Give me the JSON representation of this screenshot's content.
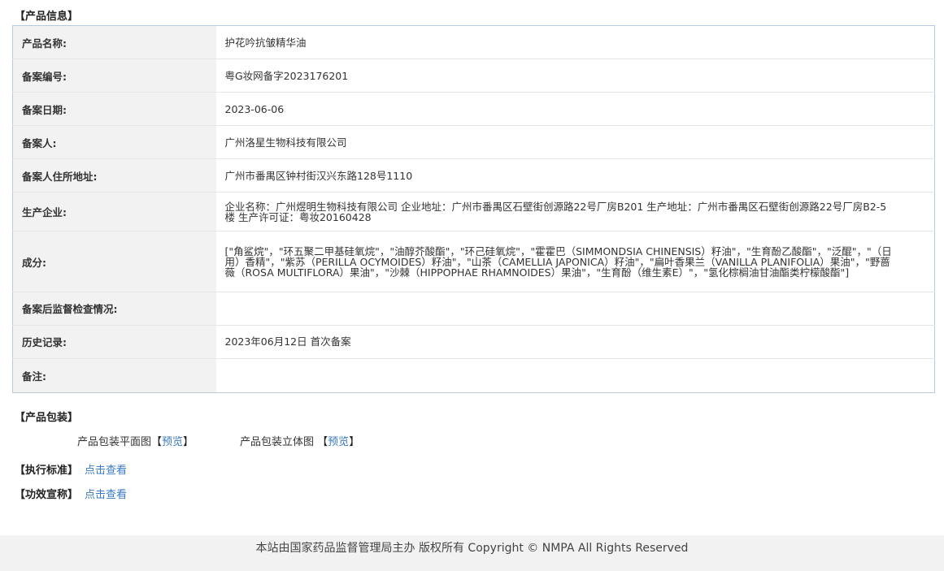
{
  "sections": {
    "product_info": "【产品信息】",
    "packaging": "【产品包装】"
  },
  "rows": [
    {
      "label": "产品名称:",
      "value": "护花吟抗皱精华油"
    },
    {
      "label": "备案编号:",
      "value": "粤G妆网备字2023176201"
    },
    {
      "label": "备案日期:",
      "value": "2023-06-06"
    },
    {
      "label": "备案人:",
      "value": "广州洛星生物科技有限公司"
    },
    {
      "label": "备案人住所地址:",
      "value": "广州市番禺区钟村街汉兴东路128号1110"
    },
    {
      "label": "生产企业:",
      "value": "企业名称：广州煜明生物科技有限公司 企业地址：广州市番禺区石壁街创源路22号厂房B201 生产地址：广州市番禺区石壁街创源路22号厂房B2-5楼 生产许可证：粤妆20160428"
    },
    {
      "label": "成分:",
      "value": "[\"角鲨烷\"，\"环五聚二甲基硅氧烷\"，\"油醇芥酸酯\"，\"环己硅氧烷\"，\"霍霍巴（SIMMONDSIA CHINENSIS）籽油\"，\"生育酚乙酸酯\"，\"泛醌\"，\"（日用）香精\"，\"紫苏（PERILLA OCYMOIDES）籽油\"，\"山茶（CAMELLIA JAPONICA）籽油\"，\"扁叶香果兰（VANILLA PLANIFOLIA）果油\"，\"野蔷薇（ROSA MULTIFLORA）果油\"，\"沙棘（HIPPOPHAE RHAMNOIDES）果油\"，\"生育酚（维生素E）\"，\"氢化棕榈油甘油酯类柠檬酸酯\"]"
    },
    {
      "label": "备案后监督检查情况:",
      "value": ""
    },
    {
      "label": "历史记录:",
      "value": "2023年06月12日 首次备案"
    },
    {
      "label": "备注:",
      "value": ""
    }
  ],
  "packaging": {
    "flat_label": "产品包装平面图",
    "solid_label": "产品包装立体图",
    "bracket_open": "【",
    "bracket_close": "】",
    "preview_link": "预览"
  },
  "standards": {
    "exec_label": "【执行标准】",
    "claim_label": "【功效宣称】",
    "view_link": "点击查看"
  },
  "footer": {
    "text": "本站由国家药品监督管理局主办 版权所有 Copyright © NMPA All Rights Reserved"
  },
  "colors": {
    "link": "#3a7ac0",
    "label_bg": "#f2f2f2",
    "table_border": "#b7c9dd",
    "footer_bg": "#f2f2f2"
  }
}
